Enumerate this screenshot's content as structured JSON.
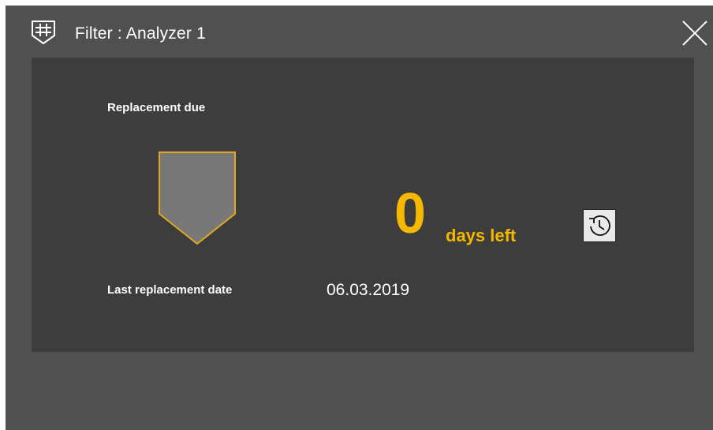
{
  "dialog": {
    "title": "Filter : Analyzer 1",
    "icons": {
      "title": "filter-shield-icon",
      "close": "close-icon",
      "history": "history-icon"
    }
  },
  "status": {
    "replacement_label": "Replacement due",
    "days_left_value": "0",
    "days_left_label": "days left",
    "last_replacement_label": "Last replacement date",
    "last_replacement_date": "06.03.2019"
  },
  "colors": {
    "accent": "#f5b800",
    "dialog_bg": "#505050",
    "panel_bg": "#3d3d3d",
    "filter_fill": "#787878"
  }
}
